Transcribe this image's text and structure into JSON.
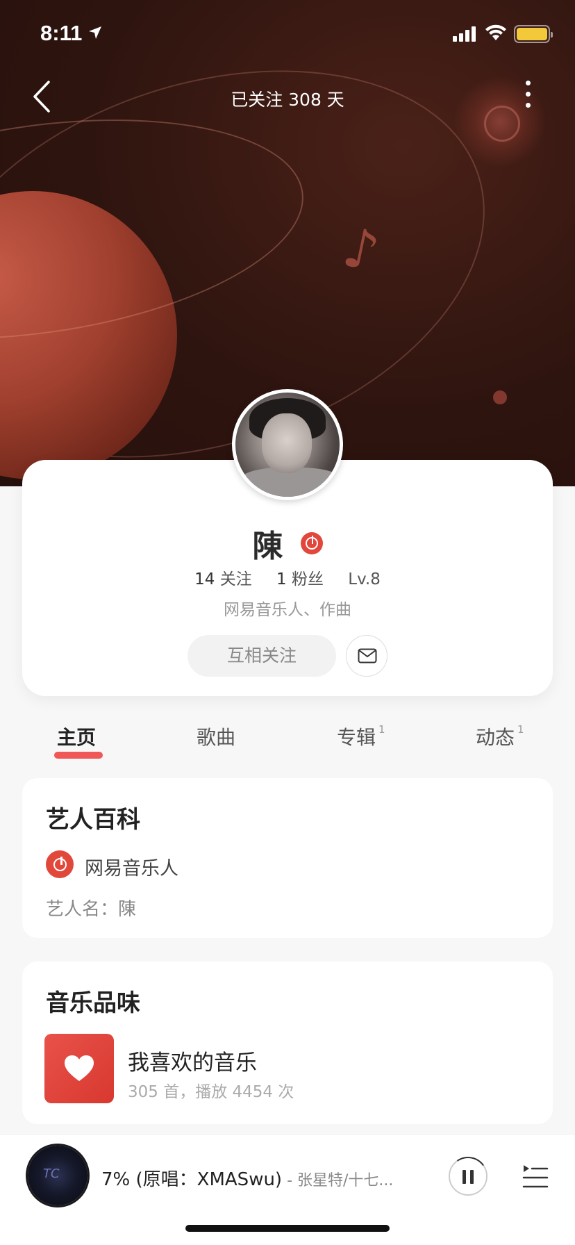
{
  "status_bar": {
    "time": "8:11",
    "battery_color": "#f2c93a"
  },
  "nav": {
    "title": "已关注 308 天",
    "back_icon": "chevron-left-icon",
    "more_icon": "more-vertical-icon"
  },
  "profile": {
    "name": "陳",
    "following_count": "14",
    "following_label": "关注",
    "followers_count": "1",
    "followers_label": "粉丝",
    "level": "Lv.8",
    "description": "网易音乐人、作曲",
    "follow_button": "互相关注",
    "message_icon": "mail-icon"
  },
  "tabs": [
    {
      "label": "主页",
      "badge": "",
      "active": true
    },
    {
      "label": "歌曲",
      "badge": ""
    },
    {
      "label": "专辑",
      "badge": "1"
    },
    {
      "label": "动态",
      "badge": "1"
    }
  ],
  "wiki": {
    "title": "艺人百科",
    "badge_label": "网易音乐人",
    "artist_name": "艺人名：陳"
  },
  "taste": {
    "title": "音乐品味",
    "playlist_title": "我喜欢的音乐",
    "playlist_sub": "305 首，播放 4454 次"
  },
  "player": {
    "disc_text": "TC",
    "song": "7% (原唱：XMASwu)",
    "artist": " - 张星特/十七...",
    "accent": "#e2473b"
  }
}
